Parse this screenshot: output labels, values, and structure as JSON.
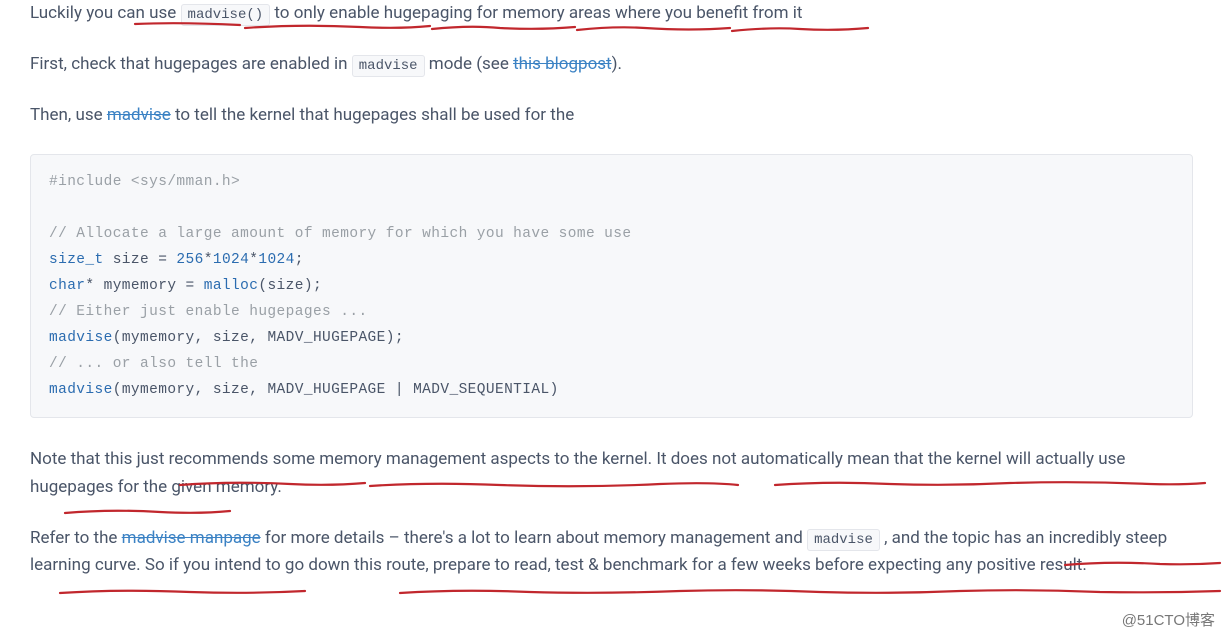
{
  "p1": {
    "t1": "Luckily you can use ",
    "code": "madvise()",
    "t2": " to only enable hugepaging for memory areas where you benefit from it"
  },
  "p2": {
    "t1": "First, check that hugepages are enabled in ",
    "code": "madvise",
    "t2": " mode (see ",
    "link": "this blogpost",
    "t3": ")."
  },
  "p3": {
    "t1": "Then, use ",
    "link": "madvise",
    "t2": " to tell the kernel that hugepages shall be used for the"
  },
  "code": {
    "l1": "#include <sys/mman.h>",
    "l2": "// Allocate a large amount of memory for which you have some use",
    "l3a": "size_t",
    "l3b": " size = ",
    "l3c": "256",
    "l3d": "*",
    "l3e": "1024",
    "l3f": "*",
    "l3g": "1024",
    "l3h": ";",
    "l4a": "char",
    "l4b": "* mymemory = ",
    "l4c": "malloc",
    "l4d": "(size);",
    "l5": "// Either just enable hugepages ...",
    "l6a": "madvise",
    "l6b": "(mymemory, size, MADV_HUGEPAGE);",
    "l7": "// ... or also tell the ",
    "l8a": "madvise",
    "l8b": "(mymemory, size, MADV_HUGEPAGE | MADV_SEQUENTIAL)"
  },
  "p4": {
    "t1": "Note that this just recommends some memory management aspects to the kernel. It does not automatically mean that the kernel will actually use hugepages for the given memory."
  },
  "p5": {
    "t1": "Refer to the ",
    "link": "madvise manpage",
    "t2": " for more details – there's a lot to learn about memory management and ",
    "code": "madvise",
    "t3": " , and the topic has an incredibly steep learning curve. So if you intend to go down this route, prepare to read, test & benchmark for a few weeks before expecting any positive result."
  },
  "watermark": "@51CTO博客",
  "underline_color": "#c1272d"
}
